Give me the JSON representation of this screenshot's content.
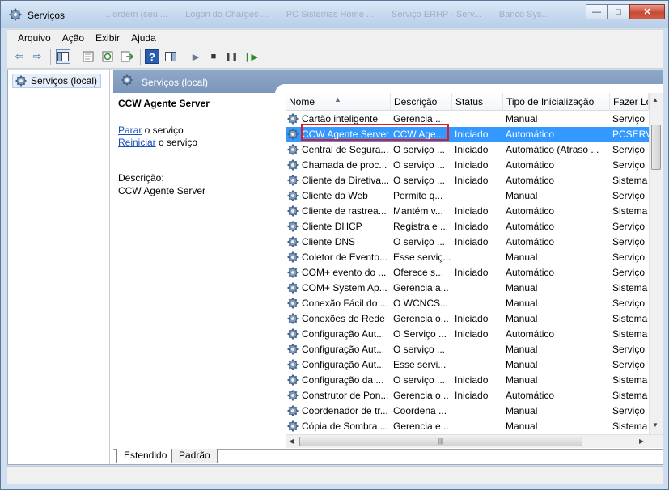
{
  "window": {
    "title": "Serviços",
    "background_tabs": [
      "... ordem (seu ...",
      "Logon do Charges ...",
      "PC Sistemas Home ...",
      "Serviço ERHP - Serv...",
      "Banco Sys..."
    ],
    "minimize_glyph": "—",
    "maximize_glyph": "□",
    "close_glyph": "✕"
  },
  "menu": [
    "Arquivo",
    "Ação",
    "Exibir",
    "Ajuda"
  ],
  "toolbar": {
    "back_glyph": "⇦",
    "forward_glyph": "⇨",
    "play_glyph": "▶",
    "stop_glyph": "■",
    "pause_glyph": "❚❚",
    "resume_glyph": "❙▶",
    "help_glyph": "?"
  },
  "tree": {
    "root_label": "Serviços (local)"
  },
  "main_header": {
    "title": "Serviços (local)"
  },
  "detail": {
    "title": "CCW Agente Server",
    "stop_link": "Parar",
    "stop_suffix": " o serviço",
    "restart_link": "Reiniciar",
    "restart_suffix": " o serviço",
    "description_label": "Descrição:",
    "description_value": "CCW Agente Server"
  },
  "columns": [
    "Nome",
    "Descrição",
    "Status",
    "Tipo de Inicialização",
    "Fazer Lo"
  ],
  "rows": [
    {
      "name": "Cartão inteligente",
      "desc": "Gerencia ...",
      "status": "",
      "startup": "Manual",
      "logon": "Serviço"
    },
    {
      "name": "CCW Agente Server",
      "desc": "CCW Age...",
      "status": "Iniciado",
      "startup": "Automático",
      "logon": "PCSERV",
      "selected": true
    },
    {
      "name": "Central de Segura...",
      "desc": "O serviço ...",
      "status": "Iniciado",
      "startup": "Automático (Atraso ...",
      "logon": "Serviço"
    },
    {
      "name": "Chamada de proc...",
      "desc": "O serviço ...",
      "status": "Iniciado",
      "startup": "Automático",
      "logon": "Serviço"
    },
    {
      "name": "Cliente da Diretiva...",
      "desc": "O serviço ...",
      "status": "Iniciado",
      "startup": "Automático",
      "logon": "Sistema"
    },
    {
      "name": "Cliente da Web",
      "desc": "Permite q...",
      "status": "",
      "startup": "Manual",
      "logon": "Serviço"
    },
    {
      "name": "Cliente de rastrea...",
      "desc": "Mantém v...",
      "status": "Iniciado",
      "startup": "Automático",
      "logon": "Sistema"
    },
    {
      "name": "Cliente DHCP",
      "desc": "Registra e ...",
      "status": "Iniciado",
      "startup": "Automático",
      "logon": "Serviço"
    },
    {
      "name": "Cliente DNS",
      "desc": "O serviço ...",
      "status": "Iniciado",
      "startup": "Automático",
      "logon": "Serviço"
    },
    {
      "name": "Coletor de Evento...",
      "desc": "Esse serviç...",
      "status": "",
      "startup": "Manual",
      "logon": "Serviço"
    },
    {
      "name": "COM+ evento do ...",
      "desc": "Oferece s...",
      "status": "Iniciado",
      "startup": "Automático",
      "logon": "Serviço"
    },
    {
      "name": "COM+ System Ap...",
      "desc": "Gerencia a...",
      "status": "",
      "startup": "Manual",
      "logon": "Sistema"
    },
    {
      "name": "Conexão Fácil do ...",
      "desc": "O WCNCS...",
      "status": "",
      "startup": "Manual",
      "logon": "Serviço"
    },
    {
      "name": "Conexões de Rede",
      "desc": "Gerencia o...",
      "status": "Iniciado",
      "startup": "Manual",
      "logon": "Sistema"
    },
    {
      "name": "Configuração Aut...",
      "desc": "O Serviço ...",
      "status": "Iniciado",
      "startup": "Automático",
      "logon": "Sistema"
    },
    {
      "name": "Configuração Aut...",
      "desc": "O serviço ...",
      "status": "",
      "startup": "Manual",
      "logon": "Serviço"
    },
    {
      "name": "Configuração Aut...",
      "desc": "Esse servi...",
      "status": "",
      "startup": "Manual",
      "logon": "Serviço"
    },
    {
      "name": "Configuração da ...",
      "desc": "O serviço ...",
      "status": "Iniciado",
      "startup": "Manual",
      "logon": "Sistema"
    },
    {
      "name": "Construtor de Pon...",
      "desc": "Gerencia o...",
      "status": "Iniciado",
      "startup": "Automático",
      "logon": "Sistema"
    },
    {
      "name": "Coordenador de tr...",
      "desc": "Coordena ...",
      "status": "",
      "startup": "Manual",
      "logon": "Serviço"
    },
    {
      "name": "Cópia de Sombra ...",
      "desc": "Gerencia e...",
      "status": "",
      "startup": "Manual",
      "logon": "Sistema"
    }
  ],
  "scroll": {
    "up_glyph": "▲",
    "down_glyph": "▼",
    "left_glyph": "◀",
    "right_glyph": "▶",
    "grip_glyph": "|||"
  },
  "tabs": [
    "Estendido",
    "Padrão"
  ],
  "colors": {
    "selection": "#3399ff",
    "highlight_border": "#e01b24",
    "link": "#1a4fb4"
  }
}
